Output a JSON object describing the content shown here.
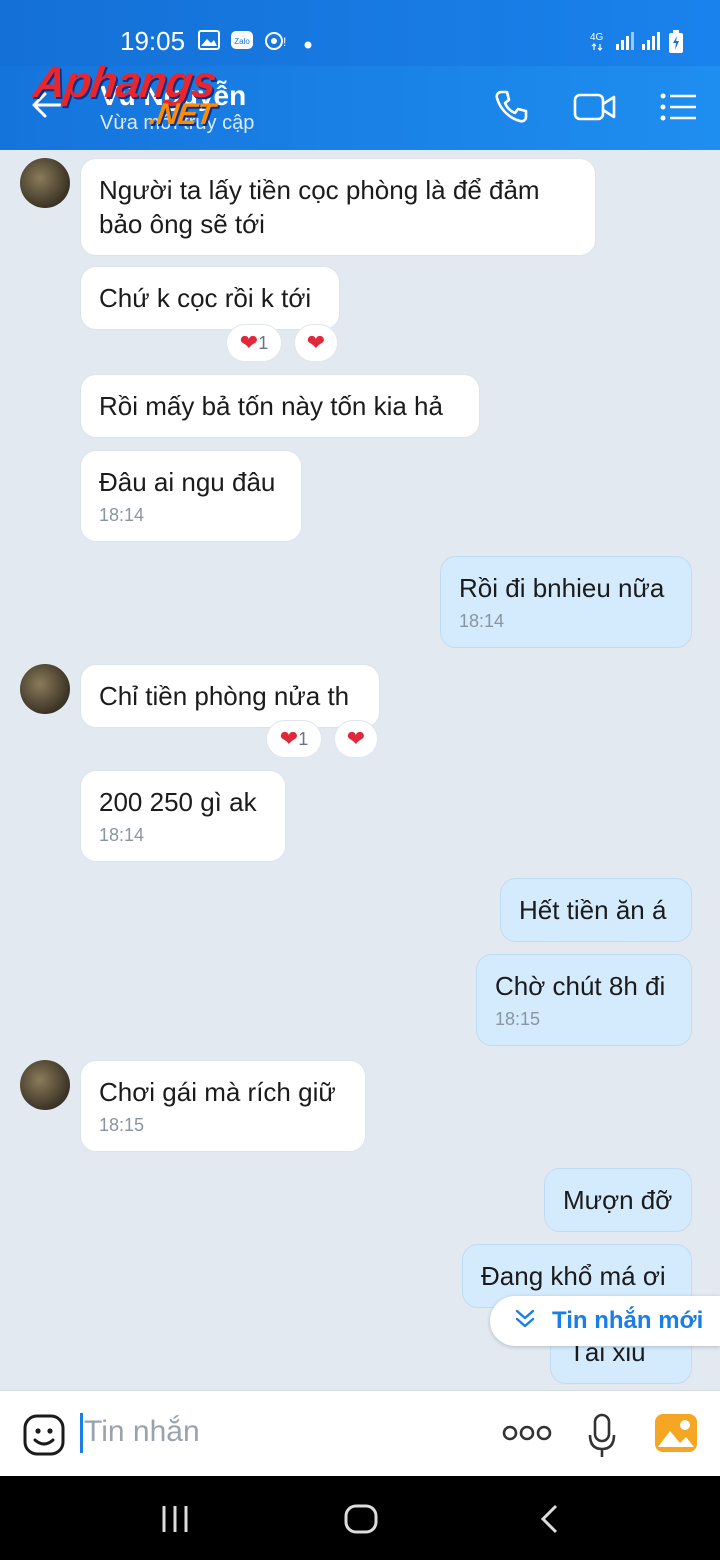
{
  "status_bar": {
    "time": "19:05",
    "network": "4G"
  },
  "header": {
    "contact_name": "Vũ Nguyễn",
    "status": "Vừa mới truy cập"
  },
  "watermark": {
    "brand": "Aphangs",
    "tld": ".NET"
  },
  "messages": [
    {
      "dir": "in",
      "text": "Người ta lấy tiền cọc phòng là để đảm bảo ông sẽ tới"
    },
    {
      "dir": "in",
      "text": "Chứ k cọc rồi k tới",
      "reaction_count": "1"
    },
    {
      "dir": "in",
      "text": "Rồi mấy bả tốn này tốn kia hả"
    },
    {
      "dir": "in",
      "text": "Đâu ai ngu đâu",
      "time": "18:14"
    },
    {
      "dir": "out",
      "text": "Rồi đi bnhieu nữa",
      "time": "18:14"
    },
    {
      "dir": "in",
      "text": "Chỉ tiền phòng nửa th",
      "reaction_count": "1"
    },
    {
      "dir": "in",
      "text": "200 250 gì ak",
      "time": "18:14"
    },
    {
      "dir": "out",
      "text": "Hết tiền ăn á"
    },
    {
      "dir": "out",
      "text": "Chờ chút 8h đi",
      "time": "18:15"
    },
    {
      "dir": "in",
      "text": "Chơi gái mà rích giữ",
      "time": "18:15"
    },
    {
      "dir": "out",
      "text": "Mượn đỡ"
    },
    {
      "dir": "out",
      "text": "Đang khổ má ơi"
    },
    {
      "dir": "out",
      "text": "Tài xỉu"
    }
  ],
  "new_messages_label": "Tin nhắn mới",
  "input": {
    "placeholder": "Tin nhắn"
  },
  "colors": {
    "accent": "#1a7ee6",
    "header": "#1574dc",
    "outgoing_bubble": "#d3ebfd",
    "background": "#e2e9f1"
  }
}
